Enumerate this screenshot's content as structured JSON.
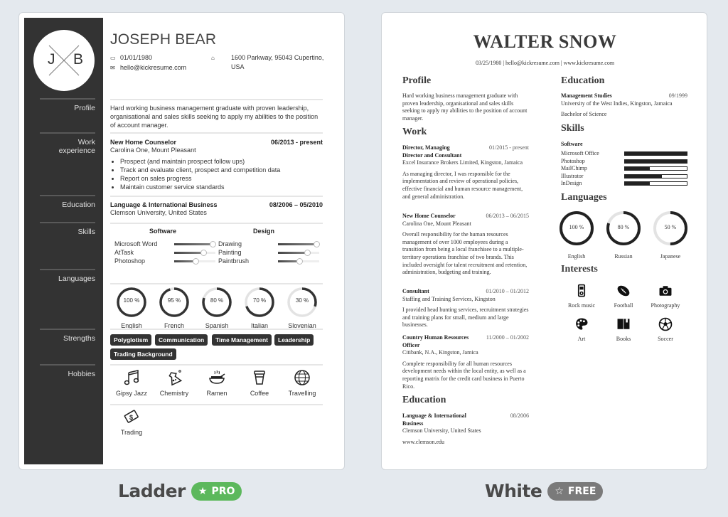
{
  "templates": [
    {
      "name": "Ladder",
      "badge": {
        "label": "PRO",
        "icon": "star-filled-icon",
        "color": "#5cb85c"
      },
      "resume": {
        "initials": [
          "J",
          "B"
        ],
        "name": "JOSEPH BEAR",
        "birthdate": "01/01/1980",
        "email": "hello@kickresume.com",
        "address": "1600 Parkway, 95043 Cupertino, USA",
        "sidebar_sections": [
          "Profile",
          "Work experience",
          "Education",
          "Skills",
          "Languages",
          "Strengths",
          "Hobbies"
        ],
        "profile": "Hard working business management graduate with proven leadership, organisational and sales skills seeking to apply my abilities to the position of account manager.",
        "work": {
          "title": "New Home Counselor",
          "dates": "06/2013 - present",
          "company": "Carolina One, Mount Pleasant",
          "bullets": [
            "Prospect (and maintain prospect follow ups)",
            "Track and evaluate client, prospect and competition data",
            "Report on sales progress",
            "Maintain customer service standards"
          ]
        },
        "education": {
          "title": "Language & International Business",
          "dates": "08/2006 – 05/2010",
          "school": "Clemson University, United States"
        },
        "skills": {
          "groups": [
            {
              "heading": "Software",
              "items": [
                {
                  "name": "Microsoft Word",
                  "level": 1.0
                },
                {
                  "name": "AtTask",
                  "level": 0.75
                },
                {
                  "name": "Photoshop",
                  "level": 0.55
                }
              ]
            },
            {
              "heading": "Design",
              "items": [
                {
                  "name": "Drawing",
                  "level": 1.0
                },
                {
                  "name": "Painting",
                  "level": 0.75
                },
                {
                  "name": "Paintbrush",
                  "level": 0.55
                }
              ]
            }
          ]
        },
        "languages": [
          {
            "name": "English",
            "label": "100 %",
            "value": 100
          },
          {
            "name": "French",
            "label": "95 %",
            "value": 95
          },
          {
            "name": "Spanish",
            "label": "80 %",
            "value": 80
          },
          {
            "name": "Italian",
            "label": "70 %",
            "value": 70
          },
          {
            "name": "Slovenian",
            "label": "30 %",
            "value": 30
          }
        ],
        "strengths": [
          "Polyglotism",
          "Communication",
          "Time Management",
          "Leadership",
          "Trading Background"
        ],
        "hobbies": [
          {
            "name": "Gipsy Jazz",
            "icon": "music-notes-icon"
          },
          {
            "name": "Chemistry",
            "icon": "flask-icon"
          },
          {
            "name": "Ramen",
            "icon": "ramen-bowl-icon"
          },
          {
            "name": "Coffee",
            "icon": "coffee-cup-icon"
          },
          {
            "name": "Travelling",
            "icon": "globe-icon"
          },
          {
            "name": "Trading",
            "icon": "money-bill-icon"
          }
        ]
      }
    },
    {
      "name": "White",
      "badge": {
        "label": "FREE",
        "icon": "star-outline-icon",
        "color": "#7a7a7a"
      },
      "resume": {
        "name": "WALTER SNOW",
        "contact": "03/25/1980 | hello@kickresume.com | www.kickresume.com",
        "headings": {
          "profile": "Profile",
          "work": "Work",
          "education": "Education",
          "skills": "Skills",
          "languages": "Languages",
          "interests": "Interests"
        },
        "profile": "Hard working business management graduate with proven leadership, organisational and sales skills seeking to apply my abilities to the position of account manager.",
        "work": [
          {
            "title": "Director, Managing Director and Consultant",
            "dates": "01/2015 - present",
            "company": "Excel Insurance Brokers Limited, Kingston, Jamaica",
            "description": "As managing director, I was responsible for the implementation and review of operational policies, effective financial and human resource management, and general administration."
          },
          {
            "title": "New Home Counselor",
            "dates": "06/2013 – 06/2015",
            "company": "Carolina One, Mount Pleasant",
            "description": "Overall responsibility for the human resources management of over 1000 employees during a transition from being a local franchisee to a multiple-territory operations franchise of two brands. This included oversight for talent recruitment and retention, administration, budgeting and training."
          },
          {
            "title": "Consultant",
            "dates": "01/2010 – 01/2012",
            "company": "Staffing and Training Services, Kingston",
            "description": "I provided head hunting services, recruitment strategies and training plans for small, medium and large businesses."
          },
          {
            "title": "Country Human Resources Officer",
            "dates": "11/2000 – 01/2002",
            "company": "Citibank, N.A., Kingston, Jamica",
            "description": "Complete responsibility for all human resources development needs within the local entity, as well as a reporting matrix for the credit card business in Puerto Rico."
          }
        ],
        "education_left": {
          "title": "Language & International Business",
          "dates": "08/2006",
          "school": "Clemson University, United States",
          "url": "www.clemson.edu"
        },
        "education_right": {
          "title": "Management Studies",
          "dates": "09/1999",
          "school": "University of the West Indies, Kingston, Jamaica",
          "degree": "Bachelor of Science"
        },
        "skills": {
          "heading": "Software",
          "items": [
            {
              "name": "Microsoft Office",
              "level": 1.0
            },
            {
              "name": "Photoshop",
              "level": 1.0
            },
            {
              "name": "MailChimp",
              "level": 0.4
            },
            {
              "name": "Illustrator",
              "level": 0.6
            },
            {
              "name": "InDesign",
              "level": 0.4
            }
          ]
        },
        "languages": [
          {
            "name": "English",
            "label": "100 %",
            "value": 100
          },
          {
            "name": "Russian",
            "label": "80 %",
            "value": 80
          },
          {
            "name": "Japanese",
            "label": "50 %",
            "value": 50
          }
        ],
        "interests": [
          {
            "name": "Rock music",
            "icon": "music-player-icon"
          },
          {
            "name": "Football",
            "icon": "football-icon"
          },
          {
            "name": "Photography",
            "icon": "camera-icon"
          },
          {
            "name": "Art",
            "icon": "palette-icon"
          },
          {
            "name": "Books",
            "icon": "book-icon"
          },
          {
            "name": "Soccer",
            "icon": "soccer-ball-icon"
          }
        ]
      }
    }
  ]
}
